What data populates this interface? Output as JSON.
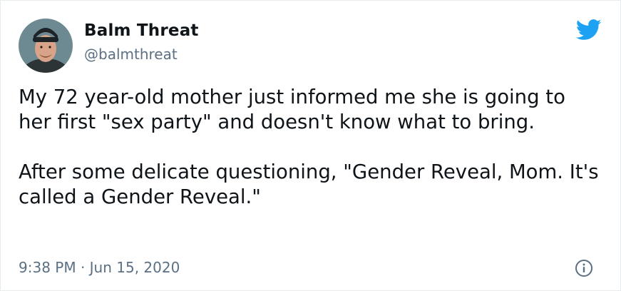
{
  "author": {
    "display_name": "Balm Threat",
    "handle": "@balmthreat",
    "avatar_icon": "profile-photo"
  },
  "tweet": {
    "paragraphs": [
      "My 72 year-old mother just informed me she is going to her first \"sex party\" and doesn't know what to bring.",
      "After some delicate questioning, \"Gender Reveal, Mom. It's called a Gender Reveal.\""
    ],
    "timestamp": "9:38 PM · Jun 15, 2020"
  },
  "icons": {
    "brand": "twitter-bird-icon",
    "info": "info-icon"
  },
  "colors": {
    "brand_blue": "#1da1f2",
    "secondary_text": "#5b7083",
    "primary_text": "#0f1419"
  }
}
